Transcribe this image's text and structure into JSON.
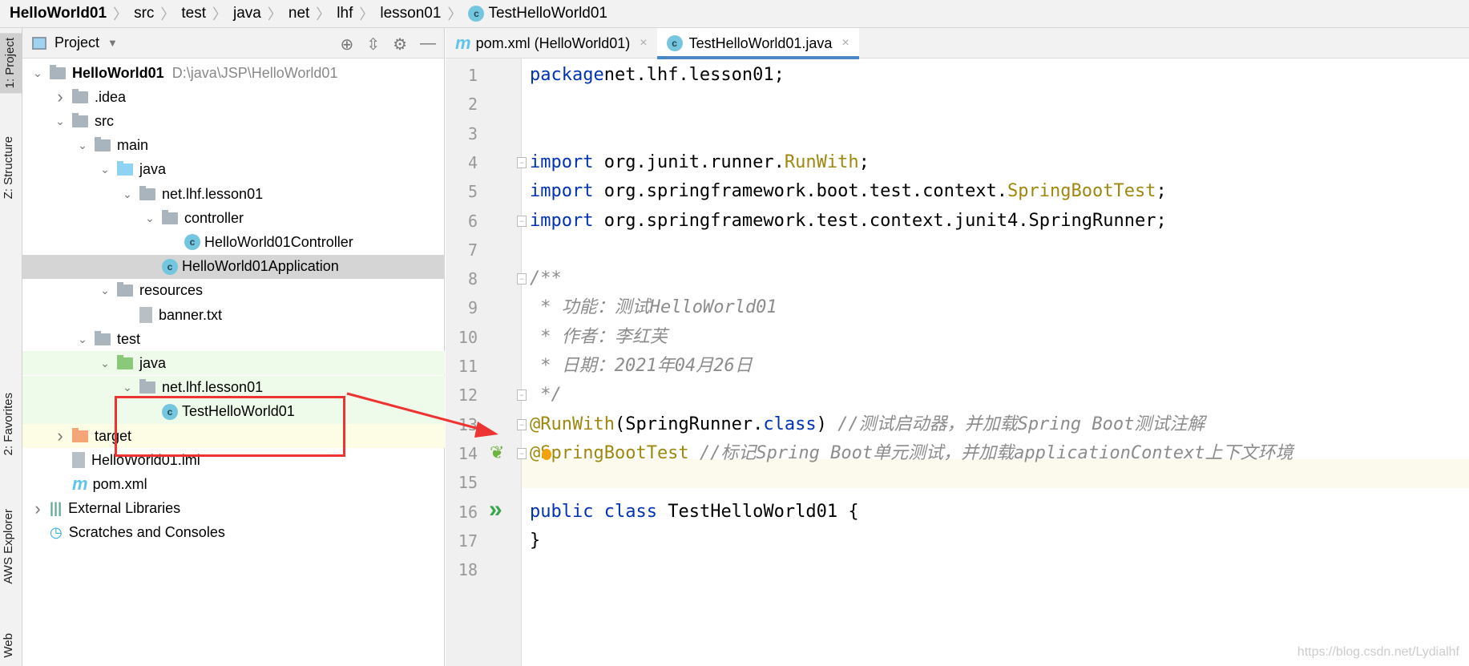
{
  "breadcrumb": [
    "HelloWorld01",
    "src",
    "test",
    "java",
    "net",
    "lhf",
    "lesson01",
    "TestHelloWorld01"
  ],
  "stripe": {
    "project": "1: Project",
    "structure": "Z: Structure",
    "favorites": "2: Favorites",
    "aws": "AWS Explorer",
    "web": "Web"
  },
  "project_panel": {
    "title": "Project",
    "root_path": "D:\\java\\JSP\\HelloWorld01",
    "tree": [
      {
        "label": "HelloWorld01",
        "level": 0,
        "expanded": true,
        "icon": "module",
        "bold": true
      },
      {
        "label": ".idea",
        "level": 1,
        "expanded": false,
        "icon": "folder"
      },
      {
        "label": "src",
        "level": 1,
        "expanded": true,
        "icon": "folder"
      },
      {
        "label": "main",
        "level": 2,
        "expanded": true,
        "icon": "folder"
      },
      {
        "label": "java",
        "level": 3,
        "expanded": true,
        "icon": "source-folder"
      },
      {
        "label": "net.lhf.lesson01",
        "level": 4,
        "expanded": true,
        "icon": "package"
      },
      {
        "label": "controller",
        "level": 5,
        "expanded": true,
        "icon": "package"
      },
      {
        "label": "HelloWorld01Controller",
        "level": 6,
        "icon": "class"
      },
      {
        "label": "HelloWorld01Application",
        "level": 5,
        "icon": "class",
        "selected": true
      },
      {
        "label": "resources",
        "level": 3,
        "expanded": true,
        "icon": "resources-folder"
      },
      {
        "label": "banner.txt",
        "level": 4,
        "icon": "text-file"
      },
      {
        "label": "test",
        "level": 2,
        "expanded": true,
        "icon": "folder"
      },
      {
        "label": "java",
        "level": 3,
        "expanded": true,
        "icon": "test-folder",
        "bg": "test"
      },
      {
        "label": "net.lhf.lesson01",
        "level": 4,
        "expanded": true,
        "icon": "package",
        "bg": "test"
      },
      {
        "label": "TestHelloWorld01",
        "level": 5,
        "icon": "class",
        "bg": "test"
      },
      {
        "label": "target",
        "level": 1,
        "expanded": false,
        "icon": "excluded-folder",
        "bg": "excluded"
      },
      {
        "label": "HelloWorld01.iml",
        "level": 1,
        "icon": "iml-file"
      },
      {
        "label": "pom.xml",
        "level": 1,
        "icon": "maven"
      },
      {
        "label": "External Libraries",
        "level": 0,
        "expanded": false,
        "icon": "libraries"
      },
      {
        "label": "Scratches and Consoles",
        "level": 0,
        "icon": "scratches"
      }
    ]
  },
  "tabs": [
    {
      "label": "pom.xml (HelloWorld01)",
      "icon": "maven",
      "active": false
    },
    {
      "label": "TestHelloWorld01.java",
      "icon": "class",
      "active": true
    }
  ],
  "editor": {
    "current_line": 15,
    "lines": [
      [
        [
          "kw",
          "package"
        ],
        [
          "",
          "net.lhf.lesson01;"
        ]
      ],
      [],
      [],
      [
        [
          "kw",
          "import"
        ],
        [
          "",
          " org.junit.runner."
        ],
        [
          "an",
          "RunWith"
        ],
        [
          "",
          ";"
        ]
      ],
      [
        [
          "kw",
          "import"
        ],
        [
          "",
          " org.springframework.boot.test.context."
        ],
        [
          "an",
          "SpringBootTest"
        ],
        [
          "",
          ";"
        ]
      ],
      [
        [
          "kw",
          "import"
        ],
        [
          "",
          " org.springframework.test.context.junit4.SpringRunner;"
        ]
      ],
      [],
      [
        [
          "cm",
          "/**"
        ]
      ],
      [
        [
          "cm",
          " * 功能：测试HelloWorld01"
        ]
      ],
      [
        [
          "cm",
          " * 作者：李红芙"
        ]
      ],
      [
        [
          "cm",
          " * 日期：2021年04月26日"
        ]
      ],
      [
        [
          "cm",
          " */"
        ]
      ],
      [
        [
          "an",
          "@RunWith"
        ],
        [
          "",
          "(SpringRunner."
        ],
        [
          "kw",
          "class"
        ],
        [
          "",
          ") "
        ],
        [
          "cm",
          "//测试启动器，并加载Spring Boot测试注解"
        ]
      ],
      [
        [
          "an",
          "@SpringBootTest"
        ],
        [
          "",
          " "
        ],
        [
          "cm",
          "//标记Spring Boot单元测试，并加载applicationContext上下文环境"
        ]
      ],
      [],
      [
        [
          "kw",
          "public"
        ],
        [
          "",
          " "
        ],
        [
          "kw",
          "class"
        ],
        [
          "",
          " TestHelloWorld01 {"
        ]
      ],
      [
        [
          "",
          "}"
        ]
      ],
      []
    ]
  },
  "watermark": "https://blog.csdn.net/Lydialhf",
  "colors": {
    "keyword": "#0033b3",
    "annotation": "#9e880d",
    "comment": "#8c8c8c",
    "accent": "#4a88c7",
    "annotation_box": "#ee3333"
  }
}
